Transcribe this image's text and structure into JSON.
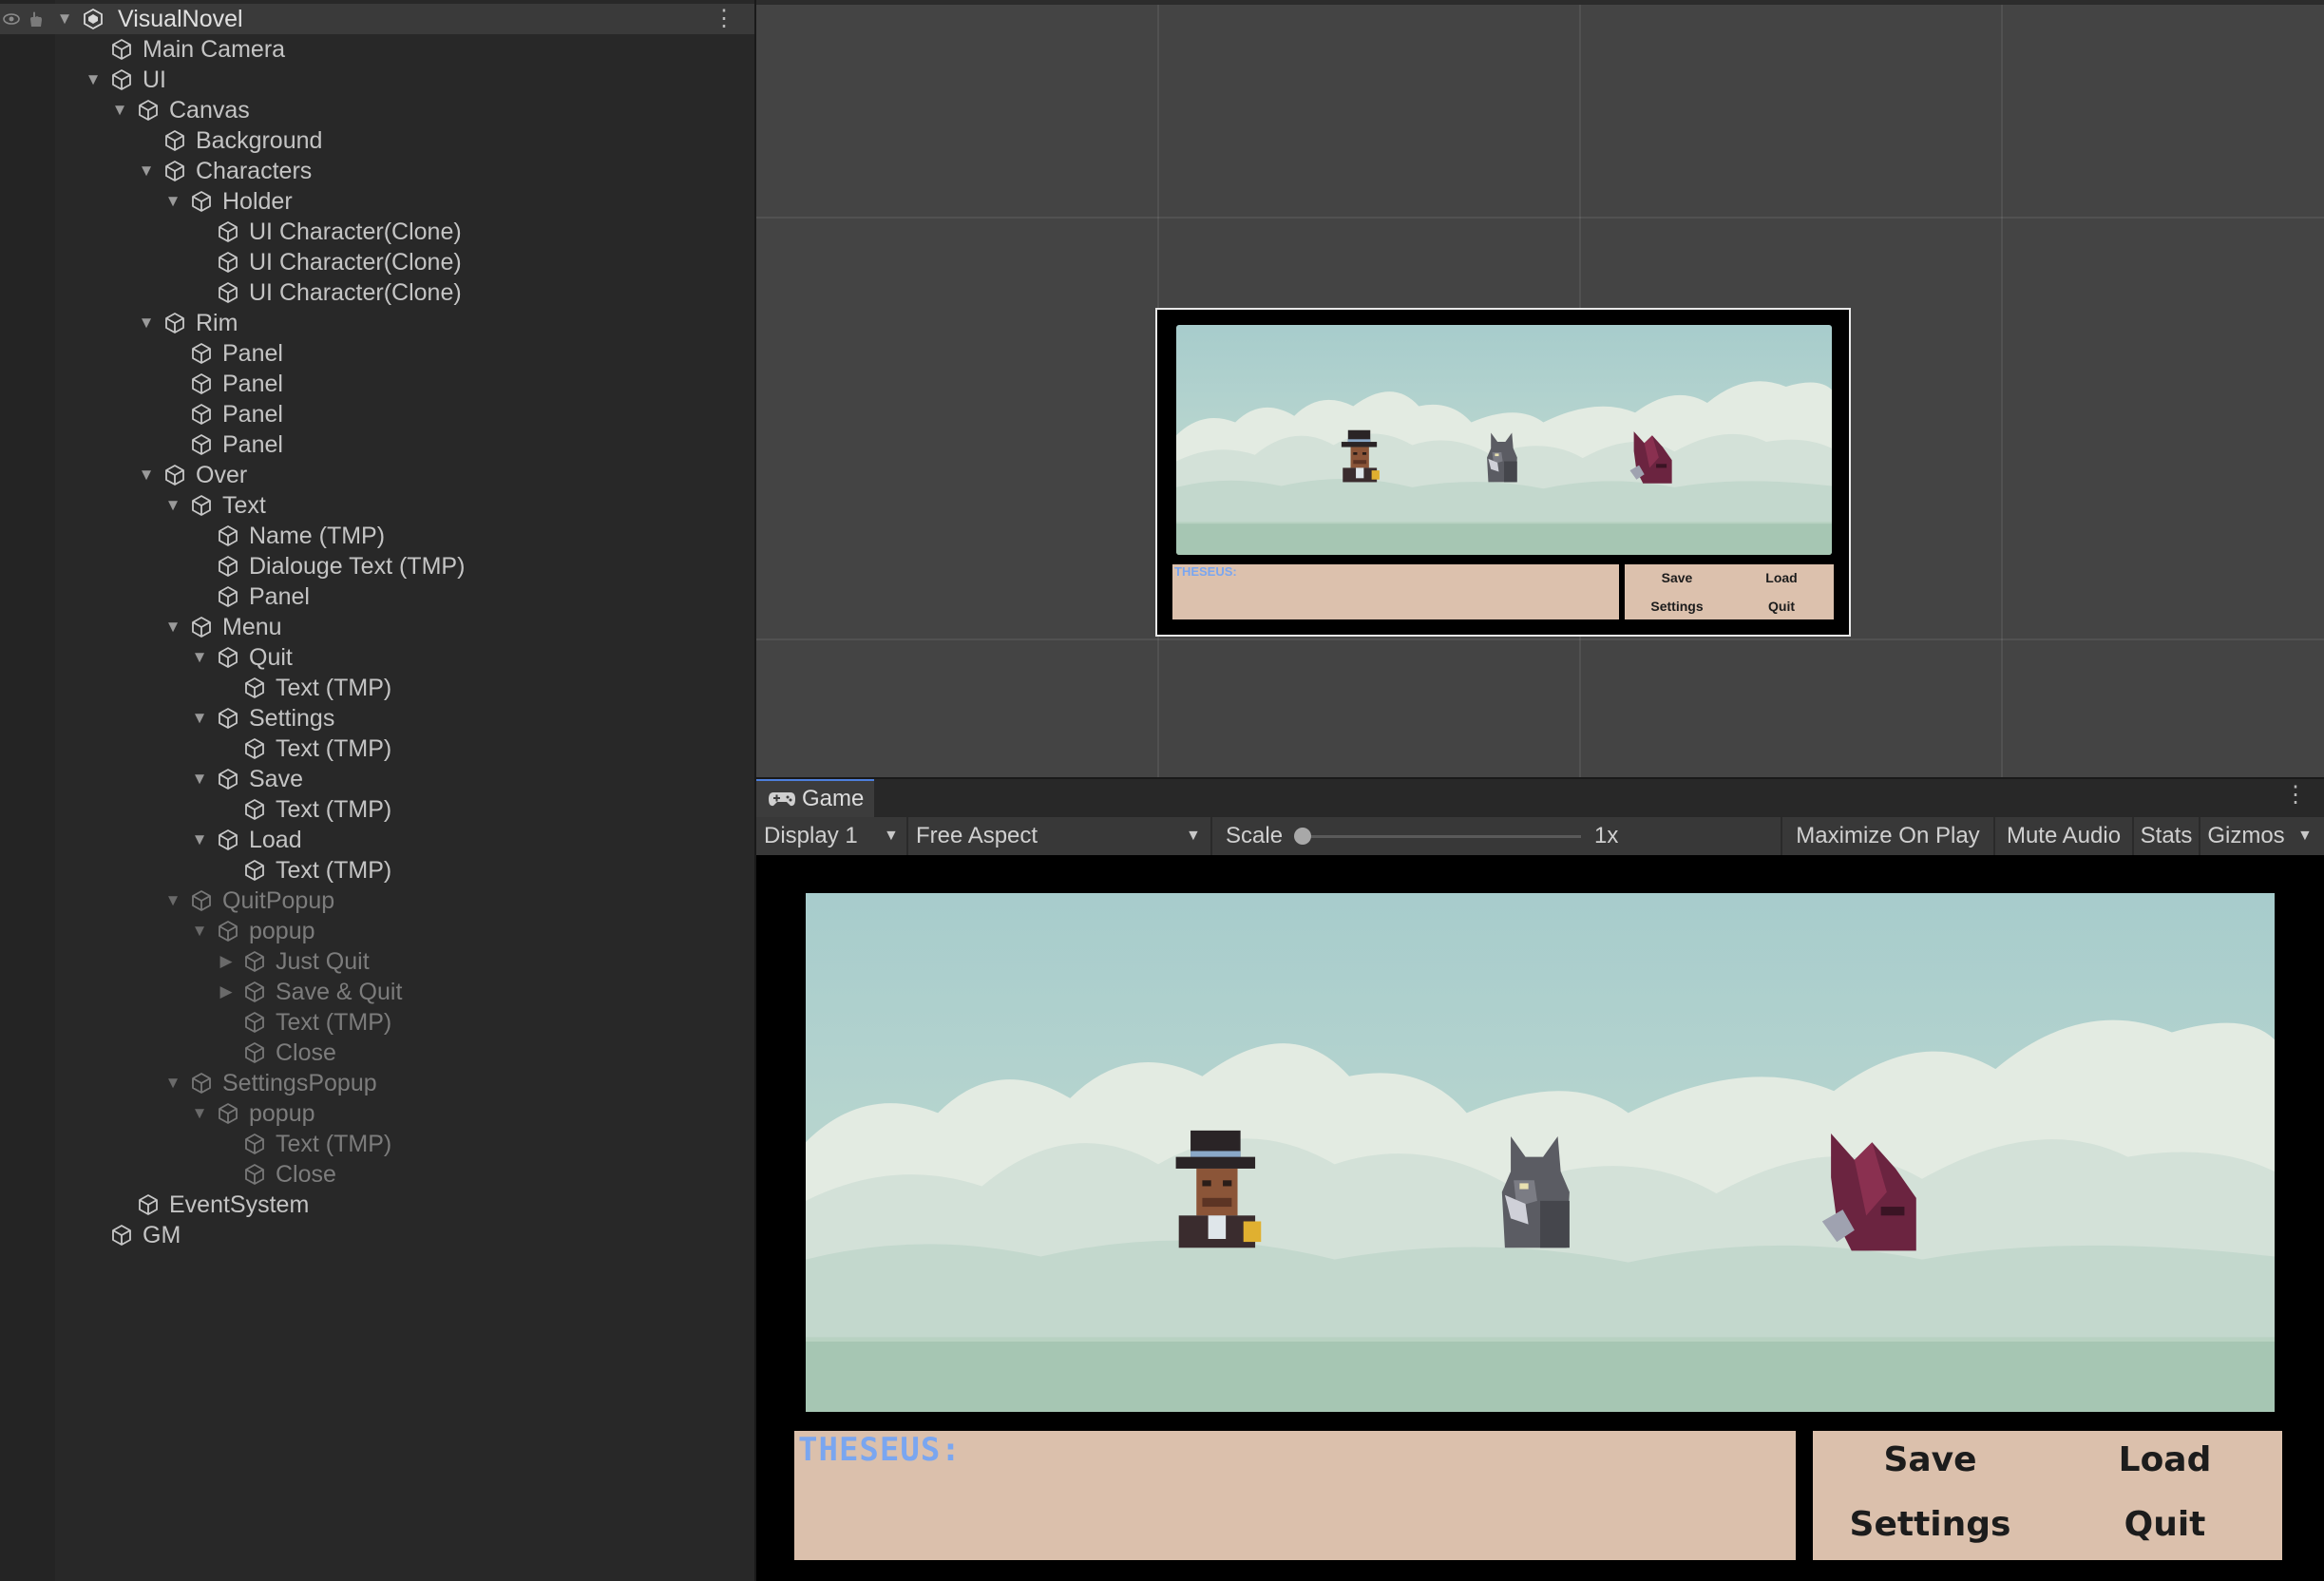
{
  "hierarchy": {
    "root": "VisualNovel",
    "items": [
      {
        "label": "Main Camera"
      },
      {
        "label": "UI"
      },
      {
        "label": "Canvas"
      },
      {
        "label": "Background"
      },
      {
        "label": "Characters"
      },
      {
        "label": "Holder"
      },
      {
        "label": "UI Character(Clone)"
      },
      {
        "label": "UI Character(Clone)"
      },
      {
        "label": "UI Character(Clone)"
      },
      {
        "label": "Rim"
      },
      {
        "label": "Panel"
      },
      {
        "label": "Panel"
      },
      {
        "label": "Panel"
      },
      {
        "label": "Panel"
      },
      {
        "label": "Over"
      },
      {
        "label": "Text"
      },
      {
        "label": "Name (TMP)"
      },
      {
        "label": "Dialouge Text (TMP)"
      },
      {
        "label": "Panel"
      },
      {
        "label": "Menu"
      },
      {
        "label": "Quit"
      },
      {
        "label": "Text (TMP)"
      },
      {
        "label": "Settings"
      },
      {
        "label": "Text (TMP)"
      },
      {
        "label": "Save"
      },
      {
        "label": "Text (TMP)"
      },
      {
        "label": "Load"
      },
      {
        "label": "Text (TMP)"
      },
      {
        "label": "QuitPopup"
      },
      {
        "label": "popup"
      },
      {
        "label": "Just Quit"
      },
      {
        "label": "Save & Quit"
      },
      {
        "label": "Text (TMP)"
      },
      {
        "label": "Close"
      },
      {
        "label": "SettingsPopup"
      },
      {
        "label": "popup"
      },
      {
        "label": "Text (TMP)"
      },
      {
        "label": "Close"
      },
      {
        "label": "EventSystem"
      },
      {
        "label": "GM"
      }
    ]
  },
  "game": {
    "tab_label": "Game",
    "toolbar": {
      "display": "Display 1",
      "aspect": "Free Aspect",
      "scale_label": "Scale",
      "scale_value": "1x",
      "maximize": "Maximize On Play",
      "mute": "Mute Audio",
      "stats": "Stats",
      "gizmos": "Gizmos"
    },
    "speaker_name": "THESEUS:",
    "menu": {
      "save": "Save",
      "load": "Load",
      "settings": "Settings",
      "quit": "Quit"
    }
  },
  "icons": {
    "visibility": "eye-icon",
    "pick": "hand-icon",
    "scene": "unity-scene-icon",
    "gameobject": "cube-icon",
    "game_tab": "gamepad-icon",
    "options": "kebab-menu-icon"
  },
  "colors": {
    "accent_tab": "#4e7fdc",
    "dialog_bg": "#dbc0ac",
    "speaker_name": "#7aa6f0",
    "sky": "#a9cdcc"
  }
}
